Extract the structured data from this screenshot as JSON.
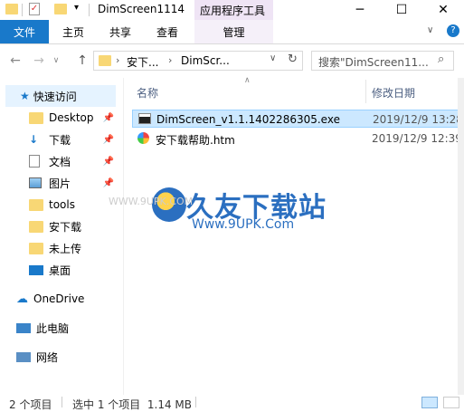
{
  "window": {
    "title": "DimScreen1114",
    "context_tab_group": "应用程序工具"
  },
  "ribbon": {
    "tabs": [
      "文件",
      "主页",
      "共享",
      "查看",
      "管理"
    ]
  },
  "address": {
    "crumbs": [
      "安下...",
      "DimScr..."
    ],
    "search_placeholder": "搜索\"DimScreen11..."
  },
  "nav": {
    "quick_access": "快速访问",
    "items": [
      {
        "label": "Desktop",
        "pinned": true
      },
      {
        "label": "下载",
        "pinned": true
      },
      {
        "label": "文档",
        "pinned": true
      },
      {
        "label": "图片",
        "pinned": true
      },
      {
        "label": "tools",
        "pinned": false
      },
      {
        "label": "安下载",
        "pinned": false
      },
      {
        "label": "未上传",
        "pinned": false
      },
      {
        "label": "桌面",
        "pinned": false
      }
    ],
    "onedrive": "OneDrive",
    "this_pc": "此电脑",
    "network": "网络"
  },
  "columns": {
    "name": "名称",
    "modified": "修改日期"
  },
  "files": [
    {
      "name": "DimScreen_v1.1.1402286305.exe",
      "date": "2019/12/9 13:28",
      "selected": true
    },
    {
      "name": "安下载帮助.htm",
      "date": "2019/12/9 12:39",
      "selected": false
    }
  ],
  "status": {
    "count": "2 个项目",
    "selection": "选中 1 个项目  1.14 MB"
  },
  "watermark": {
    "title": "久友下载站",
    "url": "Www.9UPK.Com",
    "faint": "WWW.9UPK.COM"
  }
}
